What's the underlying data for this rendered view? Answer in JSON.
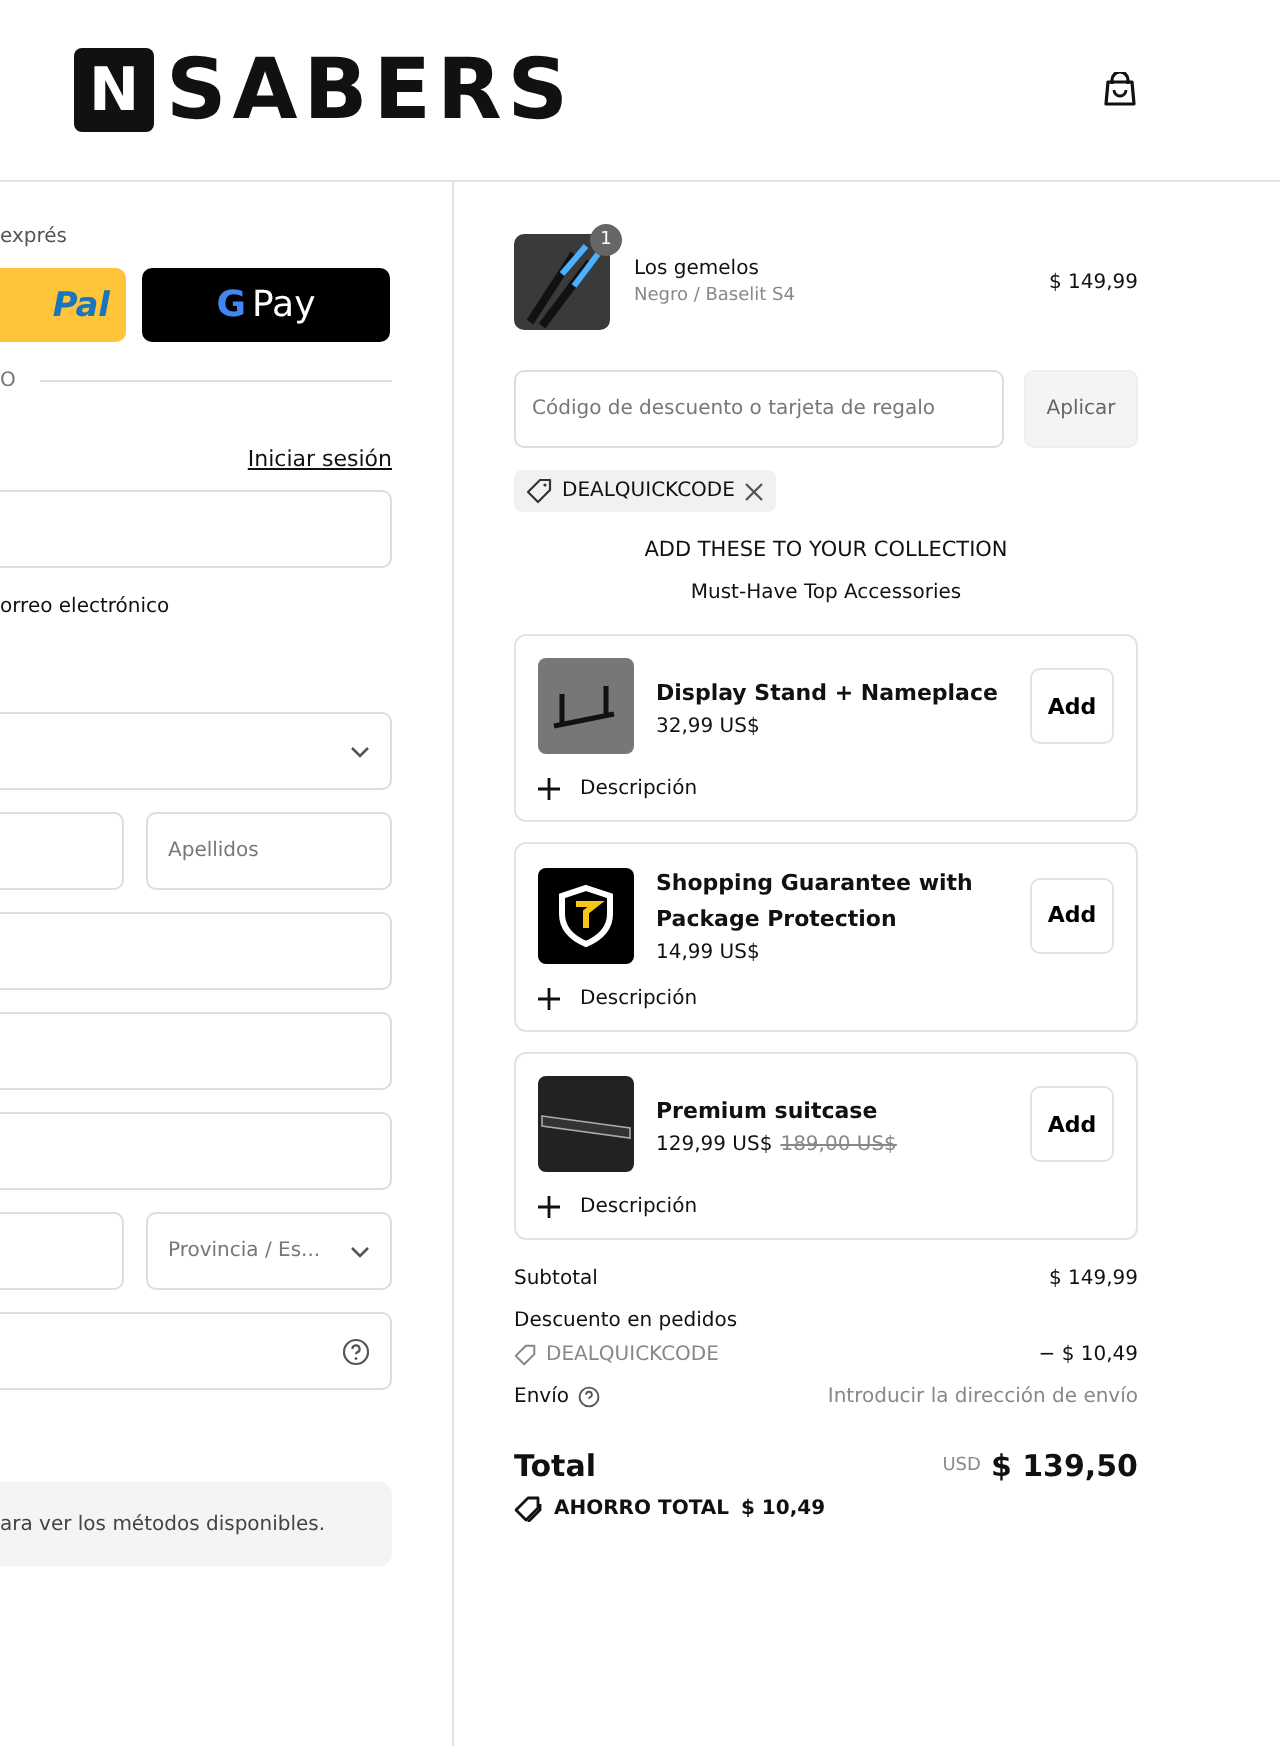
{
  "header": {
    "logo_text": "SABERS",
    "logo_mark": "N"
  },
  "checkout": {
    "express_label": "exprés",
    "paypal_text": "Pal",
    "gpay_mark": "G",
    "gpay_text": "Pay",
    "divider_text": "O",
    "login_link": "Iniciar sesión",
    "email_option": "orreo electrónico",
    "fields": [
      {
        "kind": "input"
      },
      {
        "kind": "gap"
      },
      {
        "kind": "select"
      },
      {
        "kind": "pair",
        "right_placeholder": "Apellidos",
        "right_select": false
      },
      {
        "kind": "input"
      },
      {
        "kind": "input"
      },
      {
        "kind": "input"
      },
      {
        "kind": "pair",
        "right_placeholder": "Provincia / Es...",
        "right_select": true
      },
      {
        "kind": "help"
      }
    ],
    "shipping_note": "ara ver los métodos disponibles."
  },
  "order": {
    "product": {
      "name": "Los gemelos",
      "variant": "Negro / Baselit S4",
      "price": "$ 149,99",
      "quantity": "1"
    },
    "discount_placeholder": "Código de descuento o tarjeta de regalo",
    "apply_button": "Aplicar",
    "applied_code": "DEALQUICKCODE",
    "upsell_title": "ADD THESE TO YOUR COLLECTION",
    "upsell_subtitle": "Must-Have Top Accessories",
    "upsells": [
      {
        "kind": "stand",
        "name": "Display Stand + Nameplace",
        "price": "32,99 US$",
        "button": "Add",
        "description": "Descripción"
      },
      {
        "kind": "shield",
        "name": "Shopping Guarantee with Package Protection",
        "price": "14,99 US$",
        "button": "Add",
        "description": "Descripción"
      },
      {
        "kind": "case",
        "name": "Premium suitcase",
        "price": "129,99 US$",
        "old_price": "189,00 US$",
        "button": "Add",
        "description": "Descripción"
      }
    ],
    "subtotal_label": "Subtotal",
    "subtotal": "$ 149,99",
    "discount_label": "Descuento en pedidos",
    "discount_code": "DEALQUICKCODE",
    "discount_amount": "− $ 10,49",
    "shipping_label": "Envío",
    "shipping_value": "Introducir la dirección de envío",
    "total_label": "Total",
    "currency": "USD",
    "total": "$ 139,50",
    "savings_label": "AHORRO TOTAL",
    "savings": "$ 10,49"
  }
}
